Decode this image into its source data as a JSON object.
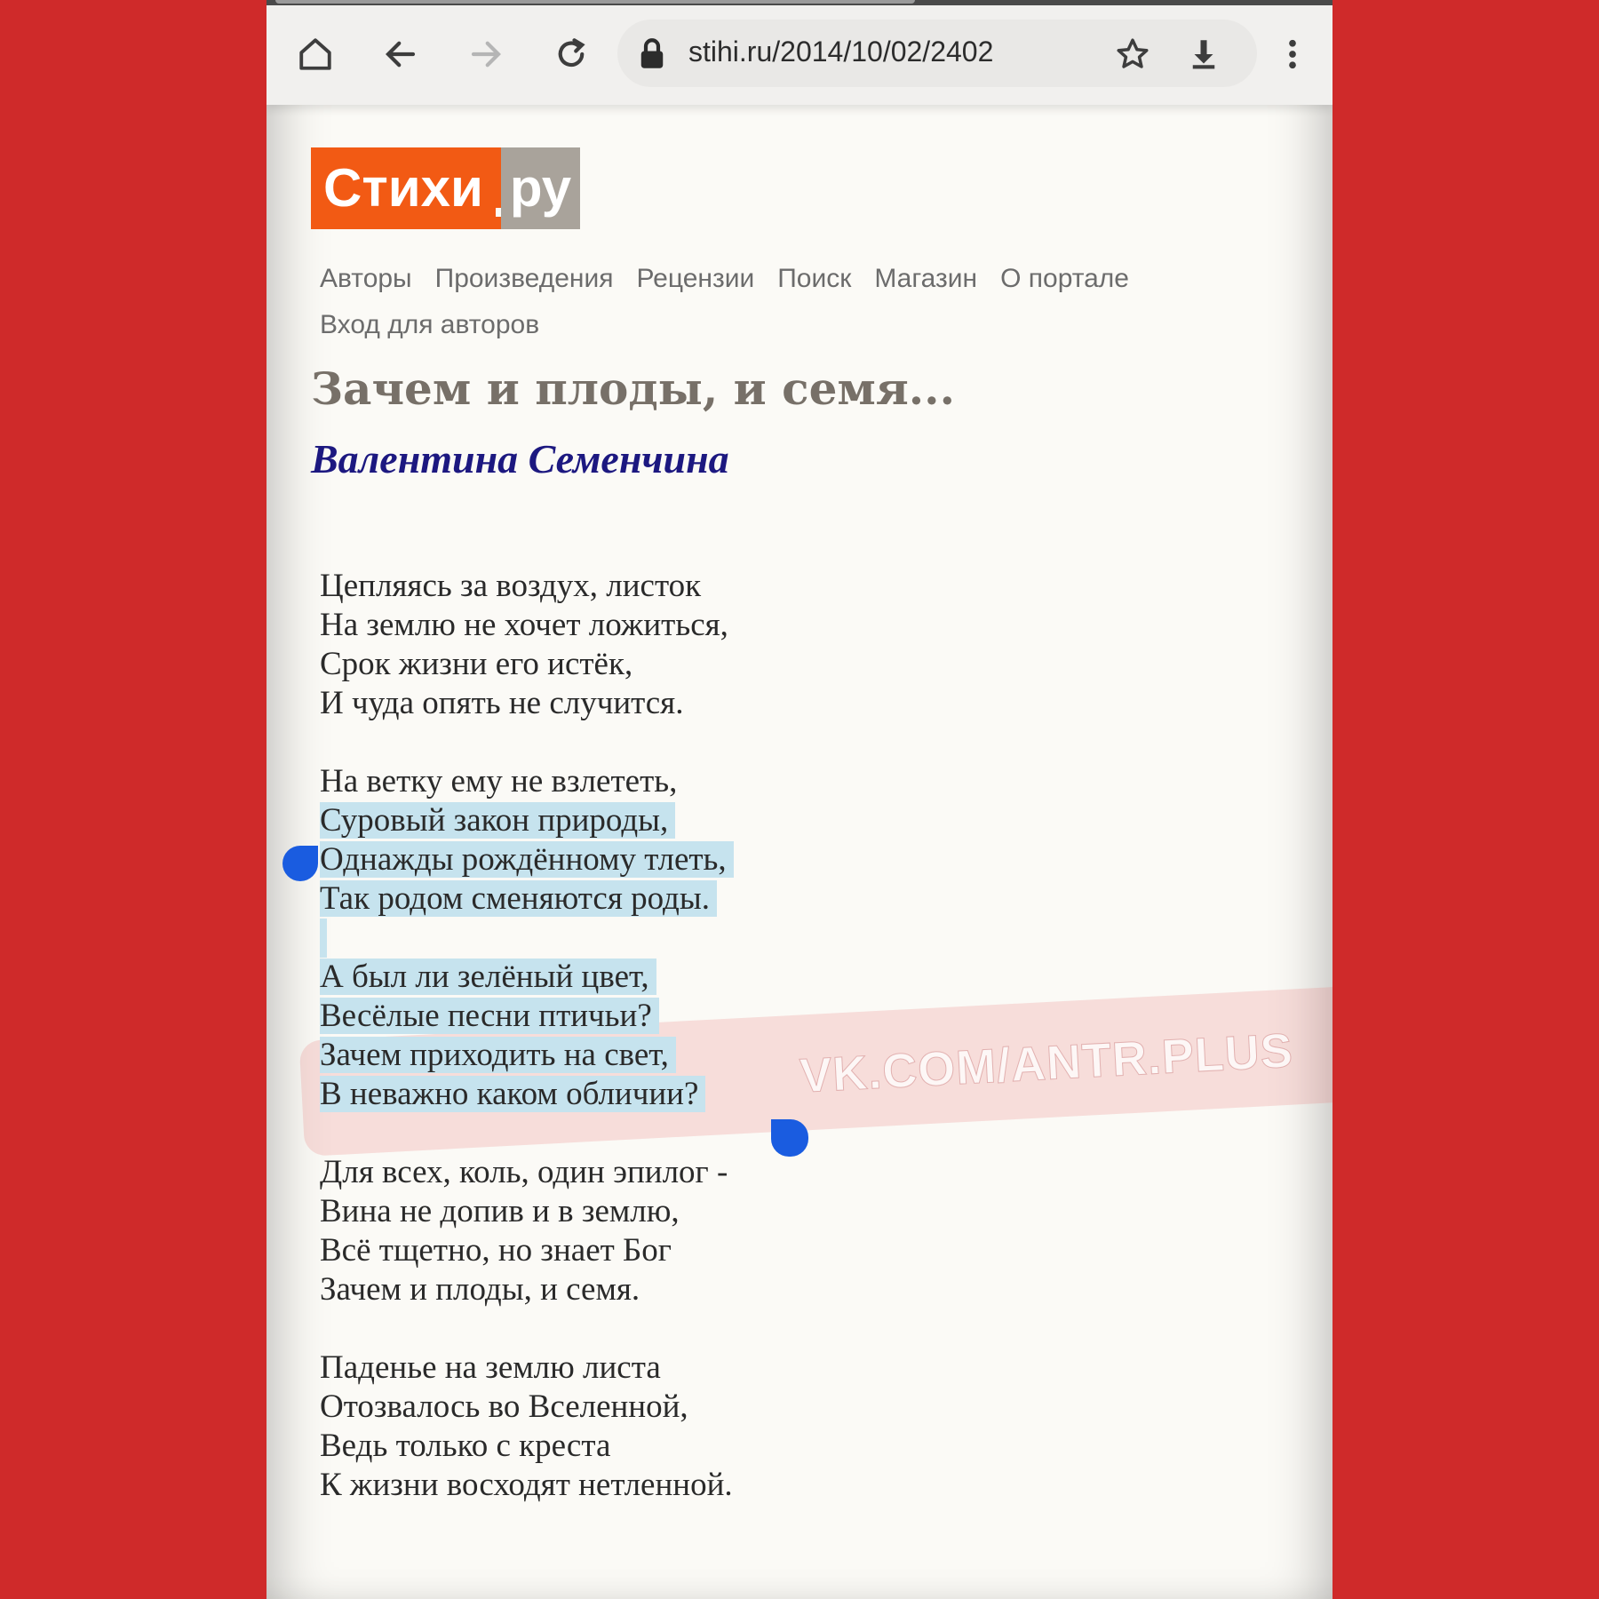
{
  "browser": {
    "url": "stihi.ru/2014/10/02/2402",
    "icons": [
      "home-icon",
      "back-arrow-icon",
      "forward-arrow-icon",
      "reload-icon",
      "lock-icon",
      "star-icon",
      "download-icon",
      "more-vert-icon"
    ]
  },
  "site": {
    "logo_main": "Стихи",
    "logo_sub": "ру",
    "nav": [
      "Авторы",
      "Произведения",
      "Рецензии",
      "Поиск",
      "Магазин",
      "О портале",
      "Вход для авторов"
    ]
  },
  "poem": {
    "title": "Зачем и плоды, и семя...",
    "author": "Валентина Семенчина",
    "stanzas": [
      [
        "Цепляясь за воздух, листок",
        "На землю не хочет ложиться,",
        "Срок жизни его истёк,",
        "И чуда опять не случится."
      ],
      [
        "На ветку ему не взлететь,",
        "Суровый закон природы,",
        "Однажды рождённому тлеть,",
        "Так родом сменяются роды."
      ],
      [
        "А был ли зелёный цвет,",
        "Весёлые песни птичьи?",
        "Зачем приходить на свет,",
        "В неважно каком обличии?"
      ],
      [
        "Для всех, коль, один эпилог -",
        "Вина не допив и в землю,",
        "Всё тщетно, но знает Бог",
        "Зачем и плоды, и семя."
      ],
      [
        "Паденье на землю листа",
        "Отозвалось во Вселенной,",
        "Ведь только с креста",
        "К жизни восходят нетленной."
      ]
    ]
  },
  "watermark": "VK.COM/ANTR.PLUS",
  "colors": {
    "background": "#cf2a2a",
    "logo_orange": "#f25a14",
    "logo_gray": "#a9a39b",
    "author": "#1c1880",
    "selection": "#c6e3ee",
    "handle": "#1a5ce0"
  }
}
